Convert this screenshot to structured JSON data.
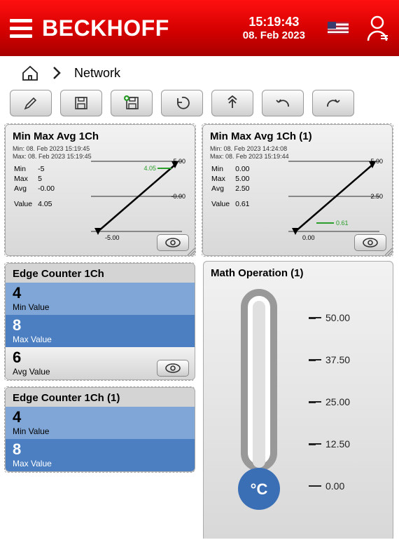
{
  "header": {
    "brand": "BECKHOFF",
    "time": "15:19:43",
    "date": "08. Feb 2023"
  },
  "breadcrumb": {
    "page": "Network"
  },
  "panels": {
    "mm1": {
      "title": "Min Max Avg 1Ch",
      "sub_min": "Min: 08. Feb 2023 15:19:45",
      "sub_max": "Max: 08. Feb 2023 15:19:45",
      "min_label": "Min",
      "min_val": "-5",
      "max_label": "Max",
      "max_val": "5",
      "avg_label": "Avg",
      "avg_val": "-0.00",
      "value_label": "Value",
      "value_val": "4.05",
      "axis_top": "5.00",
      "axis_mid": "-0.00",
      "axis_bot": "-5.00",
      "marker": "4.05"
    },
    "mm2": {
      "title": "Min Max Avg 1Ch (1)",
      "sub_min": "Min: 08. Feb 2023 14:24:08",
      "sub_max": "Max: 08. Feb 2023 15:19:44",
      "min_label": "Min",
      "min_val": "0.00",
      "max_label": "Max",
      "max_val": "5.00",
      "avg_label": "Avg",
      "avg_val": "2.50",
      "value_label": "Value",
      "value_val": "0.61",
      "axis_top": "5.00",
      "axis_mid": "2.50",
      "axis_bot": "0.00",
      "marker": "0.61"
    },
    "edge1": {
      "title": "Edge Counter 1Ch",
      "min_val": "4",
      "min_label": "Min Value",
      "max_val": "8",
      "max_label": "Max Value",
      "avg_val": "6",
      "avg_label": "Avg Value"
    },
    "edge2": {
      "title": "Edge Counter 1Ch (1)",
      "min_val": "4",
      "min_label": "Min Value",
      "max_val": "8",
      "max_label": "Max Value"
    },
    "math": {
      "title": "Math Operation (1)",
      "unit": "°C",
      "scale": [
        "50.00",
        "37.50",
        "25.00",
        "12.50",
        "0.00"
      ]
    }
  },
  "chart_data": [
    {
      "type": "line",
      "title": "Min Max Avg 1Ch",
      "series": [
        {
          "name": "Value",
          "values": [
            -5.0,
            4.05
          ]
        }
      ],
      "x": [
        0,
        1
      ],
      "ylim": [
        -5,
        5
      ],
      "current_value": 4.05,
      "min": -5,
      "max": 5,
      "avg": 0.0
    },
    {
      "type": "line",
      "title": "Min Max Avg 1Ch (1)",
      "series": [
        {
          "name": "Value",
          "values": [
            0.0,
            0.61,
            5.0
          ]
        }
      ],
      "x": [
        0,
        0.5,
        1
      ],
      "ylim": [
        0,
        5
      ],
      "current_value": 0.61,
      "min": 0.0,
      "max": 5.0,
      "avg": 2.5
    },
    {
      "type": "bar",
      "title": "Edge Counter 1Ch",
      "categories": [
        "Min Value",
        "Max Value",
        "Avg Value"
      ],
      "values": [
        4,
        8,
        6
      ]
    },
    {
      "type": "bar",
      "title": "Edge Counter 1Ch (1)",
      "categories": [
        "Min Value",
        "Max Value"
      ],
      "values": [
        4,
        8
      ]
    },
    {
      "type": "gauge",
      "title": "Math Operation (1)",
      "unit": "°C",
      "ylim": [
        0,
        50
      ],
      "ticks": [
        0.0,
        12.5,
        25.0,
        37.5,
        50.0
      ],
      "value": 0
    }
  ]
}
